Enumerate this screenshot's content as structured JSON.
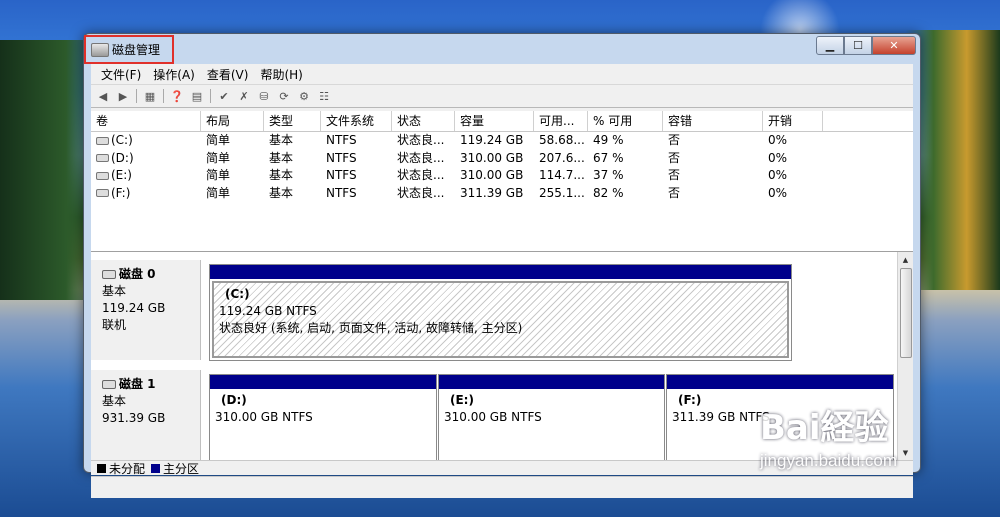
{
  "window": {
    "title": "磁盘管理"
  },
  "menu": [
    "文件(F)",
    "操作(A)",
    "查看(V)",
    "帮助(H)"
  ],
  "toolbar_icons": [
    "back-icon",
    "forward-icon",
    "view-icon",
    "help-icon",
    "properties-icon",
    "delete-icon",
    "rescan-icon",
    "disk-icon",
    "refresh-icon",
    "connect-icon"
  ],
  "columns": [
    "卷",
    "布局",
    "类型",
    "文件系统",
    "状态",
    "容量",
    "可用...",
    "% 可用",
    "容错",
    "开销"
  ],
  "volumes": [
    [
      "(C:)",
      "简单",
      "基本",
      "NTFS",
      "状态良...",
      "119.24 GB",
      "58.68...",
      "49 %",
      "否",
      "0%"
    ],
    [
      "(D:)",
      "简单",
      "基本",
      "NTFS",
      "状态良...",
      "310.00 GB",
      "207.6...",
      "67 %",
      "否",
      "0%"
    ],
    [
      "(E:)",
      "简单",
      "基本",
      "NTFS",
      "状态良...",
      "310.00 GB",
      "114.7...",
      "37 %",
      "否",
      "0%"
    ],
    [
      "(F:)",
      "简单",
      "基本",
      "NTFS",
      "状态良...",
      "311.39 GB",
      "255.1...",
      "82 %",
      "否",
      "0%"
    ]
  ],
  "disks": [
    {
      "name": "磁盘 0",
      "type": "基本",
      "size": "119.24 GB",
      "status": "联机",
      "partitions": [
        {
          "name": "(C:)",
          "size": "119.24 GB NTFS",
          "status": "状态良好 (系统, 启动, 页面文件, 活动, 故障转储, 主分区)"
        }
      ]
    },
    {
      "name": "磁盘 1",
      "type": "基本",
      "size": "931.39 GB",
      "status": "",
      "partitions": [
        {
          "name": "(D:)",
          "size": "310.00 GB NTFS"
        },
        {
          "name": "(E:)",
          "size": "310.00 GB NTFS"
        },
        {
          "name": "(F:)",
          "size": "311.39 GB NTFS"
        }
      ]
    }
  ],
  "legend": {
    "unallocated": "未分配",
    "primary": "主分区",
    "unallocated_color": "#000000",
    "primary_color": "#00008b"
  },
  "watermark": {
    "logo": "Bai経验",
    "url": "jingyan.baidu.com"
  },
  "colors": {
    "highlight": "#e0302a",
    "partition_bar": "#00008b"
  }
}
